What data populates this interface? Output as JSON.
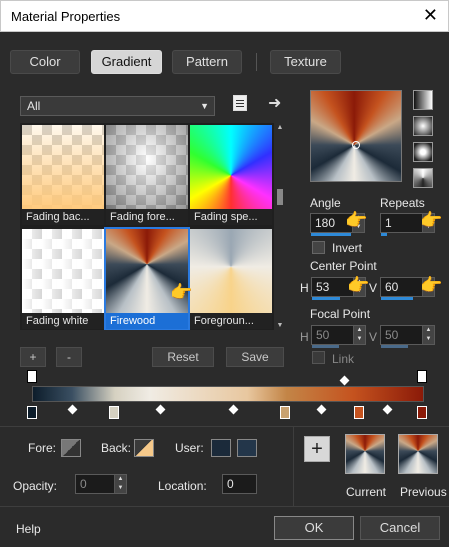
{
  "window": {
    "title": "Material Properties",
    "close": "✕"
  },
  "tabs": [
    {
      "label": "Color"
    },
    {
      "label": "Gradient"
    },
    {
      "label": "Pattern"
    },
    {
      "label": "Texture"
    }
  ],
  "category": {
    "value": "All"
  },
  "thumbnails": [
    {
      "label": "Fading bac..."
    },
    {
      "label": "Fading fore..."
    },
    {
      "label": "Fading spe..."
    },
    {
      "label": "Fading white"
    },
    {
      "label": "Firewood"
    },
    {
      "label": "Foregroun..."
    }
  ],
  "list_buttons": {
    "add": "+",
    "remove": "-",
    "reset": "Reset",
    "save": "Save"
  },
  "angle": {
    "label": "Angle",
    "value": "180"
  },
  "repeats": {
    "label": "Repeats",
    "value": "1"
  },
  "invert": {
    "label": "Invert"
  },
  "center_point": {
    "label": "Center Point",
    "h_label": "H",
    "h": "53",
    "v_label": "V",
    "v": "60"
  },
  "focal_point": {
    "label": "Focal Point",
    "h_label": "H",
    "h": "50",
    "v_label": "V",
    "v": "50"
  },
  "link": {
    "label": "Link"
  },
  "fore": {
    "label": "Fore:"
  },
  "back": {
    "label": "Back:"
  },
  "user": {
    "label": "User:"
  },
  "opacity": {
    "label": "Opacity:",
    "value": "0"
  },
  "location": {
    "label": "Location:",
    "value": "0"
  },
  "swatches": {
    "current": "Current",
    "previous": "Previous",
    "add": "+"
  },
  "footer": {
    "help": "Help",
    "ok": "OK",
    "cancel": "Cancel"
  },
  "colors": {
    "accent": "#1c6fd6",
    "firewood_dark": "#8b1a08",
    "firewood_light": "#f0ece4",
    "navy": "#0d1d2b"
  }
}
